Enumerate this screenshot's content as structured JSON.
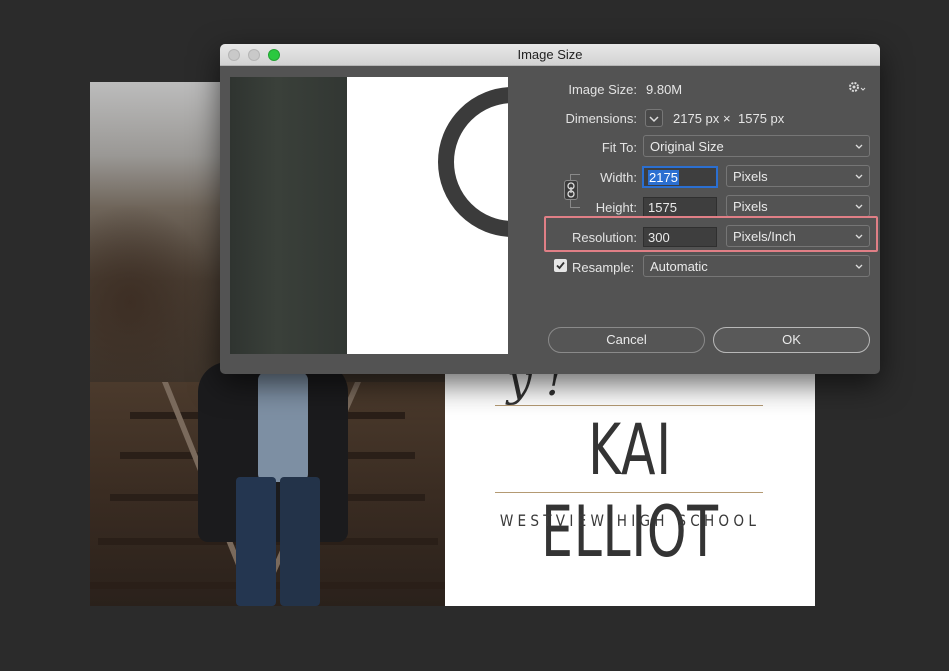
{
  "background_document": {
    "script_fragment": "y !",
    "name": "KAI ELLIOT",
    "school": "WESTVIEW HIGH SCHOOL"
  },
  "dialog": {
    "title": "Image Size",
    "image_size": {
      "label": "Image Size:",
      "value": "9.80M"
    },
    "dimensions": {
      "label": "Dimensions:",
      "width": "2175 px",
      "times": "×",
      "height": "1575 px"
    },
    "fit_to": {
      "label": "Fit To:",
      "value": "Original Size"
    },
    "width": {
      "label": "Width:",
      "value": "2175",
      "unit": "Pixels"
    },
    "height": {
      "label": "Height:",
      "value": "1575",
      "unit": "Pixels"
    },
    "resolution": {
      "label": "Resolution:",
      "value": "300",
      "unit": "Pixels/Inch"
    },
    "resample": {
      "label": "Resample:",
      "checked": true,
      "value": "Automatic"
    },
    "buttons": {
      "cancel": "Cancel",
      "ok": "OK"
    },
    "icons": [
      "gear-icon",
      "link-icon",
      "chevron-down-icon",
      "checkbox-checked-icon"
    ],
    "colors": {
      "accent": "#2b6fd1",
      "highlight_box": "#e07f86",
      "dialog_bg": "#535353"
    }
  }
}
